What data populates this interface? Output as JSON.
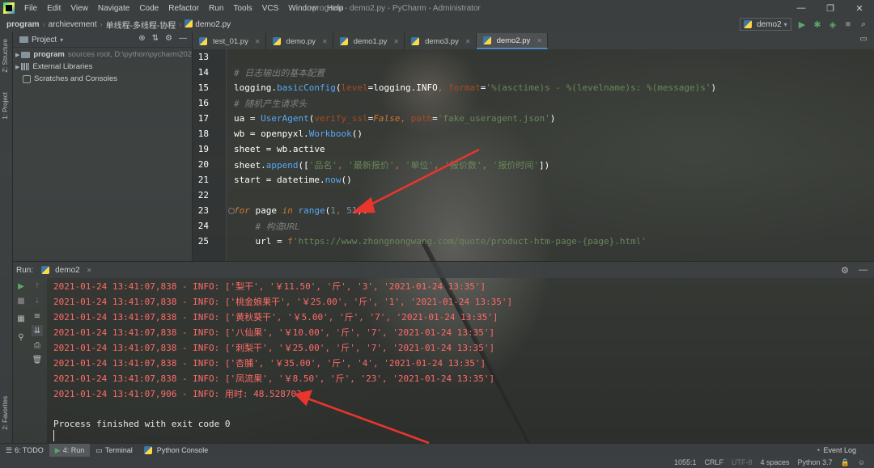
{
  "window": {
    "title": "program - demo2.py - PyCharm - Administrator",
    "controls": [
      "—",
      "❐",
      "✕"
    ]
  },
  "menu": [
    "File",
    "Edit",
    "View",
    "Navigate",
    "Code",
    "Refactor",
    "Run",
    "Tools",
    "VCS",
    "Window",
    "Help"
  ],
  "breadcrumbs": [
    "program",
    "archievement",
    "单线程-多线程-协程",
    "demo2.py"
  ],
  "run_config": {
    "label": "demo2"
  },
  "left_strip": {
    "structure": "Z: Structure",
    "project": "1: Project",
    "favorites": "2: Favorites"
  },
  "project": {
    "header": "Project",
    "tree": [
      {
        "name": "program",
        "note": "sources root,  D:\\python\\pycharm202"
      },
      {
        "name": "External Libraries",
        "note": ""
      },
      {
        "name": "Scratches and Consoles",
        "note": ""
      }
    ]
  },
  "tabs": [
    "test_01.py",
    "demo.py",
    "demo1.py",
    "demo3.py",
    "demo2.py"
  ],
  "active_tab": "demo2.py",
  "editor": {
    "line_numbers": [
      "13",
      "14",
      "15",
      "16",
      "17",
      "18",
      "19",
      "20",
      "21",
      "22",
      "23",
      "24",
      "25"
    ],
    "lines": [
      "",
      "# 日志输出的基本配置",
      "logging.basicConfig(level=logging.INFO, format='%(asctime)s - %(levelname)s: %(message)s')",
      "# 随机产生请求头",
      "ua = UserAgent(verify_ssl=False, path='fake_useragent.json')",
      "wb = openpyxl.Workbook()",
      "sheet = wb.active",
      "sheet.append(['品名', '最新报价', '单位', '报价数', '报价时间'])",
      "start = datetime.now()",
      "",
      "for page in range(1, 51):",
      "    # 构造URL",
      "    url = f'https://www.zhongnongwang.com/quote/product-htm-page-{page}.html'"
    ]
  },
  "run": {
    "title": "Run:",
    "tab": "demo2",
    "output": [
      "2021-01-24 13:41:07,838 - INFO: ['梨干', '￥11.50', '斤', '3', '2021-01-24 13:35']",
      "2021-01-24 13:41:07,838 - INFO: ['桃金娘果干', '￥25.00', '斤', '1', '2021-01-24 13:35']",
      "2021-01-24 13:41:07,838 - INFO: ['黄秋葵干', '￥5.00', '斤', '7', '2021-01-24 13:35']",
      "2021-01-24 13:41:07,838 - INFO: ['八仙果', '￥10.00', '斤', '7', '2021-01-24 13:35']",
      "2021-01-24 13:41:07,838 - INFO: ['刺梨干', '￥25.00', '斤', '7', '2021-01-24 13:35']",
      "2021-01-24 13:41:07,838 - INFO: ['杏脯', '￥35.00', '斤', '4', '2021-01-24 13:35']",
      "2021-01-24 13:41:07,838 - INFO: ['凤流果', '￥8.50', '斤', '23', '2021-01-24 13:35']",
      "2021-01-24 13:41:07,906 - INFO: 用时: 48.528703s",
      "",
      "Process finished with exit code 0"
    ]
  },
  "bottom_bar": {
    "todo": "6: TODO",
    "run": "4: Run",
    "terminal": "Terminal",
    "python_console": "Python Console",
    "event_log": "Event Log"
  },
  "status_bar": {
    "position": "1055:1",
    "line_sep": "CRLF",
    "encoding": "UTF-8",
    "indent": "4 spaces",
    "interpreter": "Python 3.7"
  },
  "colors": {
    "keyword": "#cc7832",
    "string": "#6a8759",
    "number": "#6897bb",
    "comment": "#808080",
    "console_stderr": "#ff6b68",
    "annotation_arrow": "#e8362c"
  }
}
